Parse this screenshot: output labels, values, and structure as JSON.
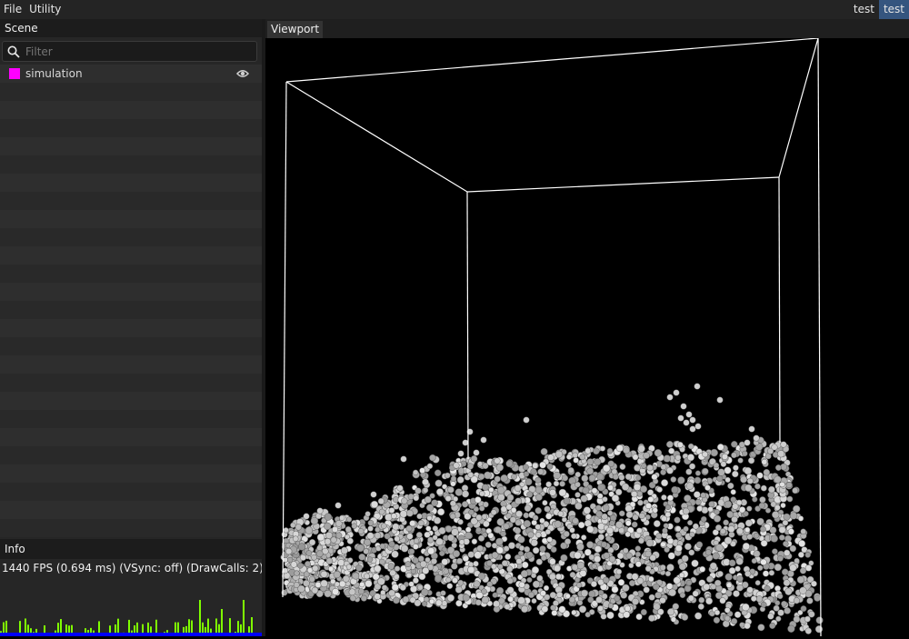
{
  "menubar": {
    "file": "File",
    "utility": "Utility",
    "right_item_1": "test",
    "right_item_2": "test"
  },
  "scene_panel": {
    "title": "Scene",
    "filter_placeholder": "Filter",
    "items": [
      {
        "label": "simulation",
        "color": "#ff00ff",
        "visible": true
      }
    ]
  },
  "info_panel": {
    "title": "Info",
    "fps_text": "1440 FPS (0.694 ms) (VSync: off) (DrawCalls: 2)",
    "graph_colors": {
      "frame": "#7fff00",
      "render": "#0000ff"
    }
  },
  "viewport": {
    "tab_label": "Viewport",
    "particle_color": "#c8c8c8",
    "box_color": "#ffffff"
  }
}
